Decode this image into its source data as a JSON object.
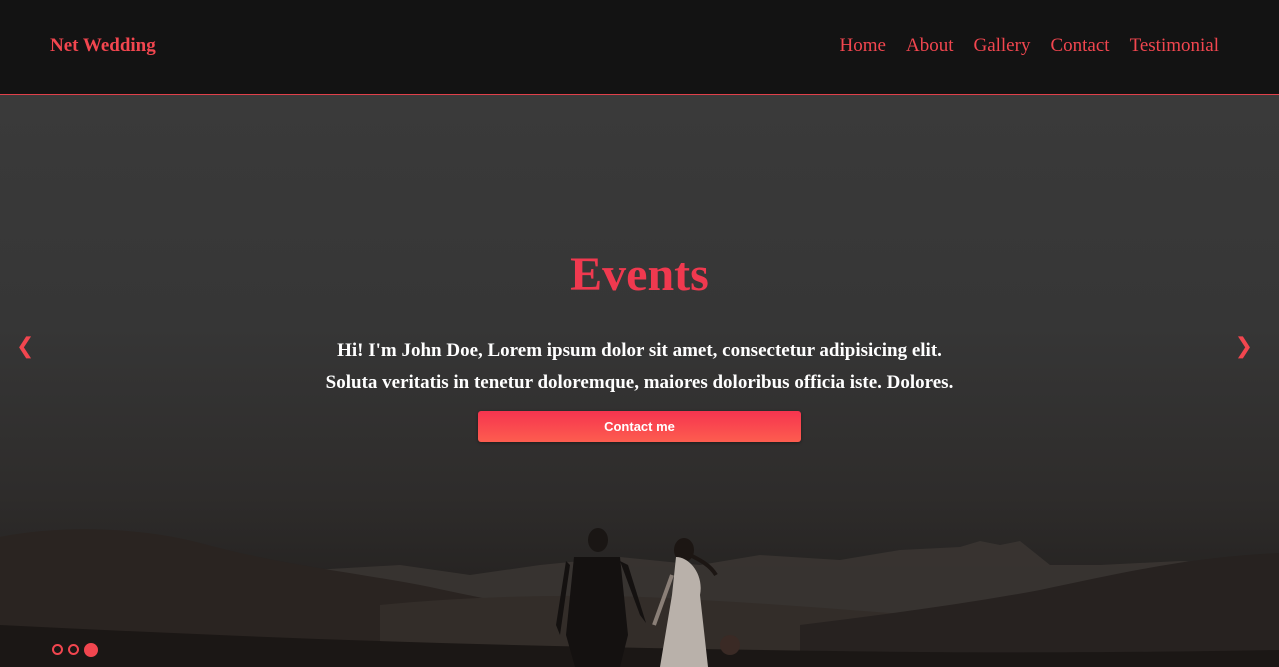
{
  "brand": {
    "name": "Net Wedding"
  },
  "nav": {
    "items": [
      {
        "label": "Home"
      },
      {
        "label": "About"
      },
      {
        "label": "Gallery"
      },
      {
        "label": "Contact"
      },
      {
        "label": "Testimonial"
      }
    ]
  },
  "hero": {
    "title": "Events",
    "text_line1": "Hi! I'm John Doe, Lorem ipsum dolor sit amet, consectetur adipisicing elit.",
    "text_line2": "Soluta veritatis in tenetur doloremque, maiores doloribus officia iste. Dolores.",
    "cta_label": "Contact me",
    "prev_arrow": "❮",
    "next_arrow": "❯"
  },
  "slider": {
    "slide_count": 3,
    "active_index": 2
  },
  "colors": {
    "accent": "#f2464f",
    "title": "#f0394f",
    "background": "#131313"
  }
}
